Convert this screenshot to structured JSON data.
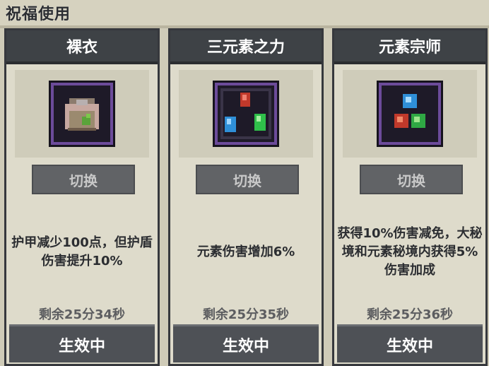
{
  "panel": {
    "title": "祝福使用"
  },
  "cards": [
    {
      "name": "裸衣",
      "icon": "naked-armor-icon",
      "switch_label": "切换",
      "description": "护甲减少100点，但护盾伤害提升10%",
      "remaining": "剩余25分34秒",
      "status_label": "生效中"
    },
    {
      "name": "三元素之力",
      "icon": "three-elements-icon",
      "switch_label": "切换",
      "description": "元素伤害增加6%",
      "remaining": "剩余25分35秒",
      "status_label": "生效中"
    },
    {
      "name": "元素宗师",
      "icon": "element-master-icon",
      "switch_label": "切换",
      "description": "获得10%伤害减免，大秘境和元素秘境内获得5%伤害加成",
      "remaining": "剩余25分36秒",
      "status_label": "生效中"
    }
  ],
  "colors": {
    "card_header": "#3e4246",
    "icon_frame_border": "#6c4b9a",
    "button": "#616366"
  }
}
